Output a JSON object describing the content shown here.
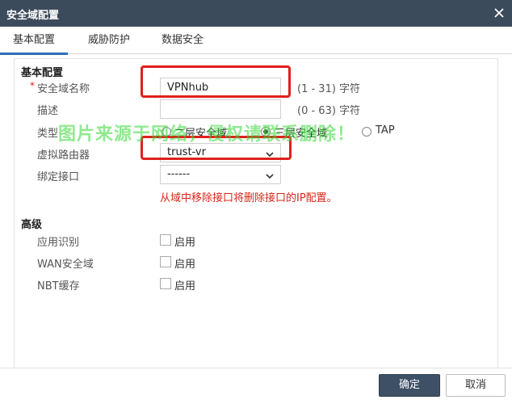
{
  "titlebar": {
    "title": "安全域配置",
    "close_icon": "close-icon"
  },
  "tabs": [
    {
      "label": "基本配置",
      "active": true
    },
    {
      "label": "威胁防护",
      "active": false
    },
    {
      "label": "数据安全",
      "active": false
    }
  ],
  "basic": {
    "section_title": "基本配置",
    "name_required_mark": "*",
    "name_label": "安全域名称",
    "name_value": "VPNhub",
    "name_hint": "(1 - 31) 字符",
    "desc_label": "描述",
    "desc_value": "",
    "desc_hint": "(0 - 63) 字符",
    "type_label": "类型",
    "type_options": [
      {
        "label": "二层安全域",
        "checked": false
      },
      {
        "label": "三层安全域",
        "checked": true
      },
      {
        "label": "TAP",
        "checked": false
      }
    ],
    "vrouter_label": "虚拟路由器",
    "vrouter_value": "trust-vr",
    "bind_label": "绑定接口",
    "bind_value": "------",
    "bind_warning": "从域中移除接口将删除接口的IP配置。"
  },
  "advanced": {
    "section_title": "高级",
    "app_label": "应用识别",
    "app_enable": "启用",
    "wan_label": "WAN安全域",
    "wan_enable": "启用",
    "nbt_label": "NBT缓存",
    "nbt_enable": "启用"
  },
  "footer": {
    "ok_label": "确定",
    "cancel_label": "取消"
  },
  "watermark": "图片来源于网络，侵权请联系删除！",
  "colors": {
    "titlebar_bg": "#3c4b5c",
    "primary_button": "#3d5066",
    "highlight_box": "#e0201c",
    "warning_text": "#d9271c",
    "watermark": "#35d835",
    "active_tab_underline": "#2f6fb5"
  }
}
